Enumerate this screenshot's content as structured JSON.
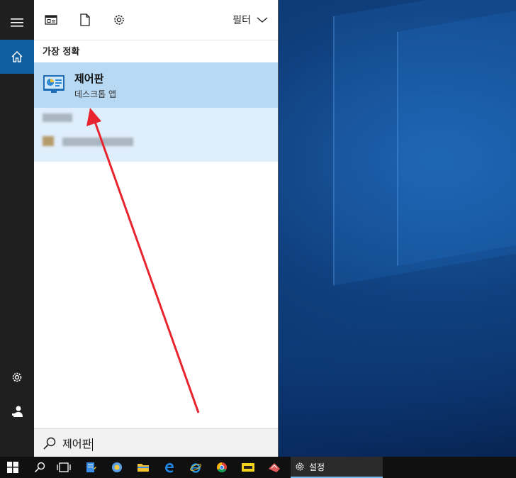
{
  "toolbar": {
    "filter_label": "필터",
    "icons": [
      "apps-icon",
      "document-icon",
      "settings-icon"
    ]
  },
  "results": {
    "section_title": "가장 정확",
    "best_match": {
      "name": "제어판",
      "subtitle": "데스크톱 앱",
      "icon": "control-panel-icon"
    }
  },
  "search": {
    "value": "제어판",
    "icon": "search-icon"
  },
  "sidebar": {
    "items": [
      "menu-icon",
      "home-icon",
      "settings-icon",
      "user-icon"
    ]
  },
  "taskbar": {
    "active_app_label": "설정",
    "apps": [
      "start",
      "search",
      "task-view",
      "notepad",
      "paint",
      "file-explorer",
      "edge",
      "internet-explorer",
      "chrome",
      "pdf",
      "ruler-app"
    ]
  },
  "colors": {
    "accent": "#0f5f9e",
    "best_match_bg": "#b8d9f3",
    "arrow": "#e8242f"
  }
}
